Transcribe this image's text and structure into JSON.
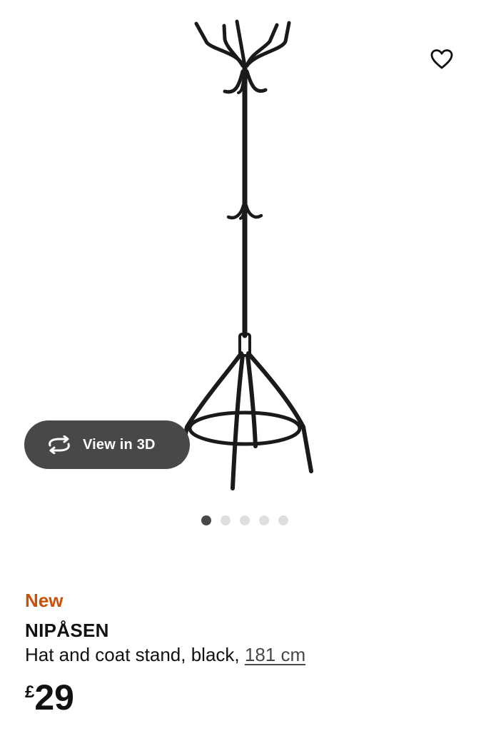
{
  "product": {
    "badge": "New",
    "name": "NIPÅSEN",
    "description": "Hat and coat stand, black, ",
    "size_link": "181 cm",
    "price_currency": "£",
    "price_amount": "29"
  },
  "gallery": {
    "view3d_label": "View in 3D",
    "image_count": 5,
    "active_index": 0
  },
  "icons": {
    "favorite": "heart-outline-icon",
    "view3d": "rotate-3d-icon"
  },
  "colors": {
    "accent_new": "#ca5008",
    "dark_button": "#484848",
    "text": "#111111",
    "dot_inactive": "#dfdfdf"
  }
}
